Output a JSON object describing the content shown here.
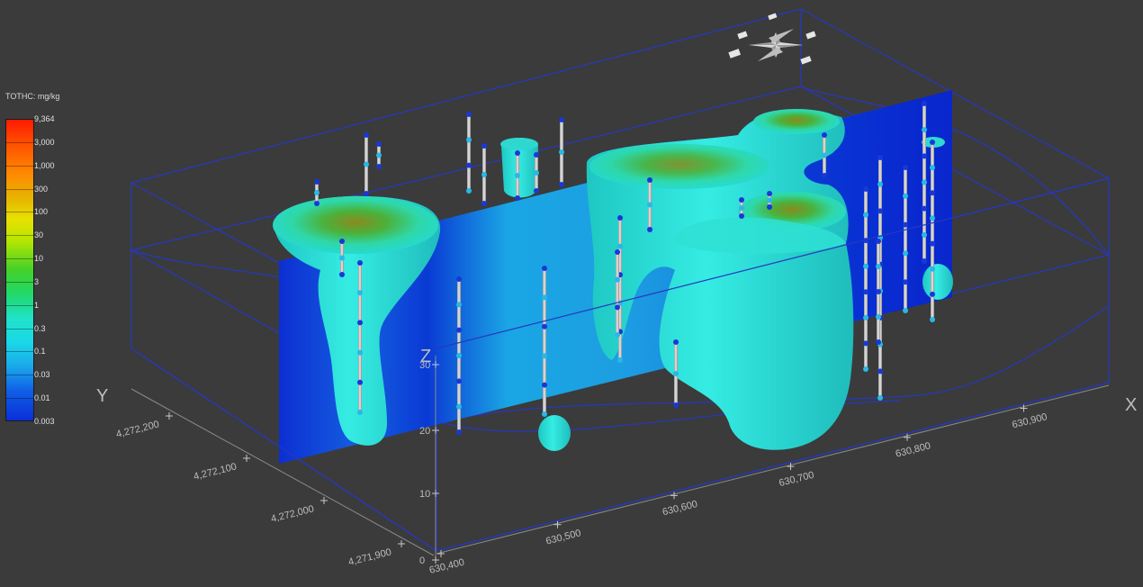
{
  "legend": {
    "title": "TOTHC: mg/kg",
    "ticks": [
      "9,364",
      "3,000",
      "1,000",
      "300",
      "100",
      "30",
      "10",
      "3",
      "1",
      "0.3",
      "0.1",
      "0.03",
      "0.01",
      "0.003"
    ]
  },
  "axes": {
    "x_title": "X",
    "y_title": "Y",
    "z_title": "Z",
    "x_ticks": [
      "630,400",
      "630,500",
      "630,600",
      "630,700",
      "630,800",
      "630,900"
    ],
    "y_ticks": [
      "4,271,900",
      "4,272,000",
      "4,272,100",
      "4,272,200"
    ],
    "z_ticks": [
      "0",
      "10",
      "20",
      "30"
    ]
  },
  "compass": {
    "icon": "compass-rose-icon"
  },
  "colors": {
    "background": "#3b3b3b",
    "frame": "#2a3cc4",
    "plume": "#26e0d8",
    "section_low": "#0a2fd6",
    "section_mid": "#17b7e8"
  }
}
